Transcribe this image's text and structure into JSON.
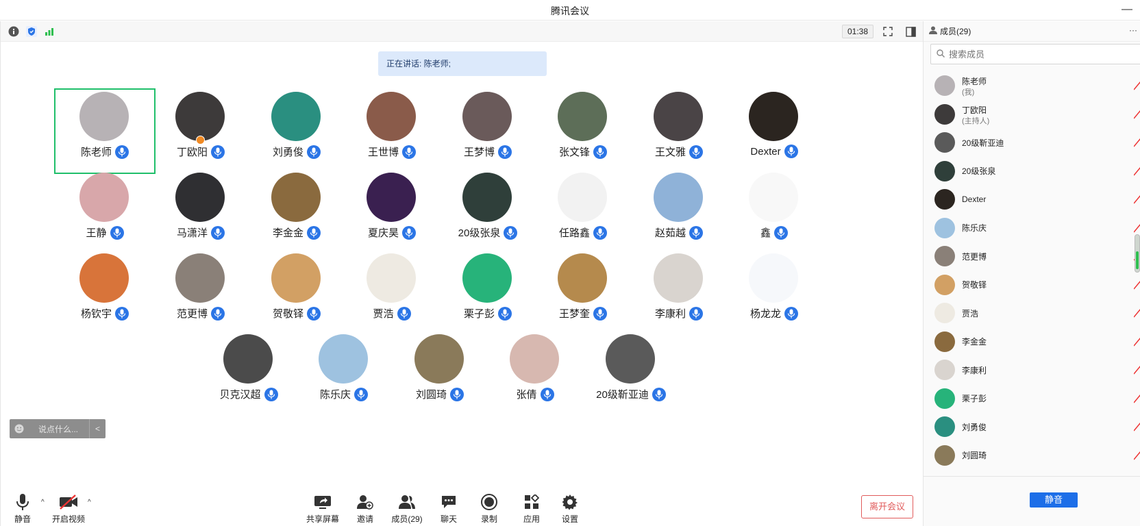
{
  "window": {
    "title": "腾讯会议",
    "minimize": "—"
  },
  "toolbar": {
    "timer": "01:38"
  },
  "speaking": {
    "text": "正在讲话: 陈老师;"
  },
  "participants": [
    {
      "name": "陈老师",
      "active": true,
      "color": "#b7b2b5"
    },
    {
      "name": "丁欧阳",
      "host": true,
      "color": "#3d3a3a"
    },
    {
      "name": "刘勇俊",
      "color": "#2a8f80"
    },
    {
      "name": "王世博",
      "color": "#8a5b4a"
    },
    {
      "name": "王梦博",
      "color": "#6a5a5a"
    },
    {
      "name": "张文锋",
      "color": "#5d6e58"
    },
    {
      "name": "王文雅",
      "color": "#4a4446"
    },
    {
      "name": "Dexter",
      "color": "#2b2520"
    },
    {
      "name": "王静",
      "color": "#d8a7aa"
    },
    {
      "name": "马潇洋",
      "color": "#2f2f32"
    },
    {
      "name": "李金金",
      "color": "#8a6a3e"
    },
    {
      "name": "夏庆昊",
      "color": "#3a2050"
    },
    {
      "name": "20级张泉",
      "color": "#2f3f3a"
    },
    {
      "name": "任路鑫",
      "color": "#f2f2f2"
    },
    {
      "name": "赵茹越",
      "color": "#8fb2d8"
    },
    {
      "name": "鑫",
      "color": "#f8f8f8"
    },
    {
      "name": "杨钦宇",
      "color": "#d8743a"
    },
    {
      "name": "范更博",
      "color": "#8a8078"
    },
    {
      "name": "贺敬铎",
      "color": "#d2a064"
    },
    {
      "name": "贾浩",
      "color": "#eeeae2"
    },
    {
      "name": "栗子彭",
      "color": "#27b37a"
    },
    {
      "name": "王梦奎",
      "color": "#b58a4d"
    },
    {
      "name": "李康利",
      "color": "#d9d4cf"
    },
    {
      "name": "杨龙龙",
      "color": "#f6f8fb"
    },
    {
      "name": "贝克汉超",
      "color": "#4b4b4b"
    },
    {
      "name": "陈乐庆",
      "color": "#9ec2e0"
    },
    {
      "name": "刘圆琦",
      "color": "#8a7a5a"
    },
    {
      "name": "张倩",
      "color": "#d7b8b0"
    },
    {
      "name": "20级靳亚迪",
      "color": "#5a5a5a"
    }
  ],
  "chat": {
    "placeholder": "说点什么...",
    "arrow": "<"
  },
  "bottom": {
    "mute": "静音",
    "video": "开启视频",
    "share": "共享屏幕",
    "invite": "邀请",
    "members": "成员(29)",
    "chat": "聊天",
    "record": "录制",
    "apps": "应用",
    "settings": "设置",
    "leave": "离开会议",
    "caret": "^"
  },
  "panel": {
    "title": "成员(29)",
    "more": "···",
    "search_placeholder": "搜索成员",
    "members": [
      {
        "name": "陈老师",
        "tag": "(我)",
        "color": "#b7b2b5"
      },
      {
        "name": "丁欧阳",
        "tag": "(主持人)",
        "color": "#3d3a3a"
      },
      {
        "name": "20级靳亚迪",
        "color": "#5a5a5a"
      },
      {
        "name": "20级张泉",
        "color": "#2f3f3a"
      },
      {
        "name": "Dexter",
        "color": "#2b2520"
      },
      {
        "name": "陈乐庆",
        "color": "#9ec2e0"
      },
      {
        "name": "范更博",
        "color": "#8a8078"
      },
      {
        "name": "贺敬铎",
        "color": "#d2a064"
      },
      {
        "name": "贾浩",
        "color": "#eeeae2"
      },
      {
        "name": "李金金",
        "color": "#8a6a3e"
      },
      {
        "name": "李康利",
        "color": "#d9d4cf"
      },
      {
        "name": "栗子彭",
        "color": "#27b37a"
      },
      {
        "name": "刘勇俊",
        "color": "#2a8f80"
      },
      {
        "name": "刘圆琦",
        "color": "#8a7a5a"
      }
    ],
    "mute_all": "静音"
  },
  "colors": {
    "accent": "#2b75e6",
    "active_border": "#1fbf6a",
    "leave": "#e15a5a",
    "speaking_bg": "#dce9fb"
  }
}
